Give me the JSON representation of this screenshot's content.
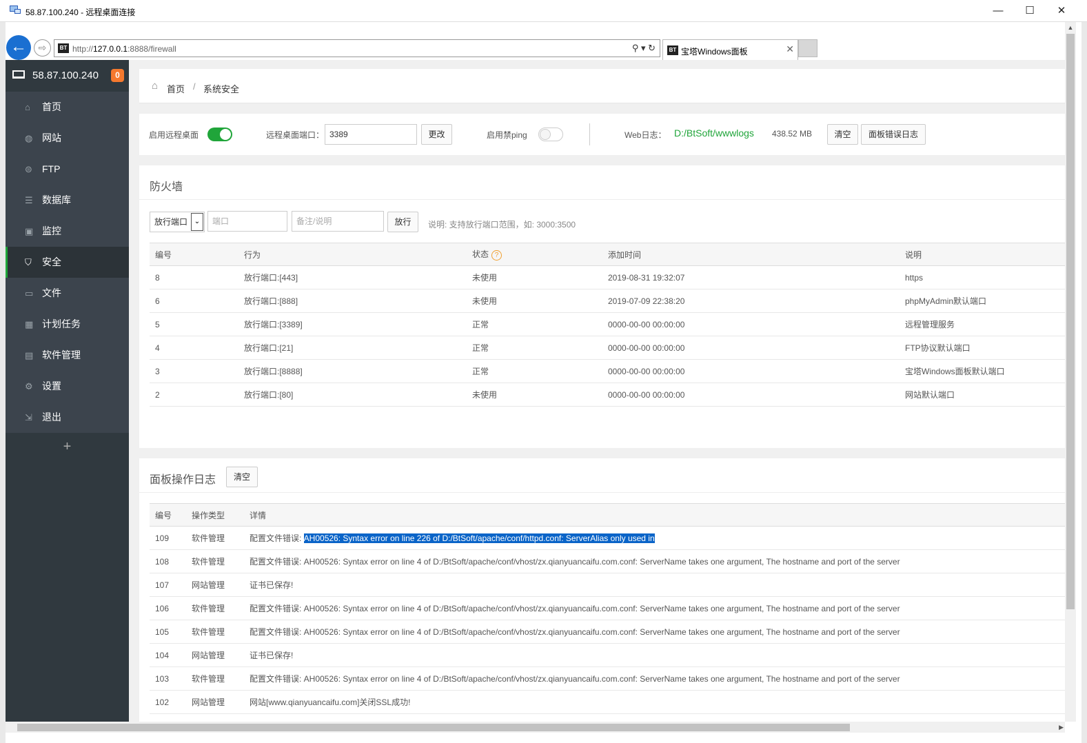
{
  "window": {
    "title": "58.87.100.240 - 远程桌面连接",
    "minimize": "—",
    "maximize": "☐",
    "close": "✕"
  },
  "browser": {
    "url_prefix": "http://",
    "url_host": "127.0.0.1",
    "url_path": ":8888/firewall",
    "tools": "⚲ ▾ ↻",
    "tab_title": "宝塔Windows面板",
    "tab_close": "✕",
    "bt_logo": "BT"
  },
  "sidebar": {
    "ip": "58.87.100.240",
    "badge": "0",
    "add": "+",
    "items": [
      {
        "label": "首页",
        "icon": "⌂"
      },
      {
        "label": "网站",
        "icon": "◍"
      },
      {
        "label": "FTP",
        "icon": "⊜"
      },
      {
        "label": "数据库",
        "icon": "☰"
      },
      {
        "label": "监控",
        "icon": "▣"
      },
      {
        "label": "安全",
        "icon": "⛉"
      },
      {
        "label": "文件",
        "icon": "▭"
      },
      {
        "label": "计划任务",
        "icon": "▦"
      },
      {
        "label": "软件管理",
        "icon": "▤"
      },
      {
        "label": "设置",
        "icon": "⚙"
      },
      {
        "label": "退出",
        "icon": "⇲"
      }
    ]
  },
  "breadcrumb": {
    "home": "首页",
    "sep": "/",
    "current": "系统安全"
  },
  "controls": {
    "remote_desktop_label": "启用远程桌面",
    "remote_port_label": "远程桌面端口：",
    "remote_port_value": "3389",
    "change_btn": "更改",
    "ping_label": "启用禁ping",
    "weblog_label": "Web日志：",
    "weblog_path": "D:/BtSoft/wwwlogs",
    "weblog_size": "438.52 MB",
    "clear_btn": "清空",
    "panel_error_btn": "面板错误日志"
  },
  "firewall": {
    "title": "防火墙",
    "select_value": "放行端口",
    "select_arrow": "⌄",
    "port_placeholder": "端口",
    "note_placeholder": "备注/说明",
    "allow_btn": "放行",
    "hint": "说明: 支持放行端口范围，如: 3000:3500",
    "headers": {
      "id": "编号",
      "action": "行为",
      "status": "状态",
      "status_help": "?",
      "time": "添加时间",
      "note": "说明"
    },
    "rows": [
      {
        "id": "8",
        "action": "放行端口:[443]",
        "status": "未使用",
        "time": "2019-08-31 19:32:07",
        "note": "https"
      },
      {
        "id": "6",
        "action": "放行端口:[888]",
        "status": "未使用",
        "time": "2019-07-09 22:38:20",
        "note": "phpMyAdmin默认端口"
      },
      {
        "id": "5",
        "action": "放行端口:[3389]",
        "status": "正常",
        "time": "0000-00-00 00:00:00",
        "note": "远程管理服务"
      },
      {
        "id": "4",
        "action": "放行端口:[21]",
        "status": "正常",
        "time": "0000-00-00 00:00:00",
        "note": "FTP协议默认端口"
      },
      {
        "id": "3",
        "action": "放行端口:[8888]",
        "status": "正常",
        "time": "0000-00-00 00:00:00",
        "note": "宝塔Windows面板默认端口"
      },
      {
        "id": "2",
        "action": "放行端口:[80]",
        "status": "未使用",
        "time": "0000-00-00 00:00:00",
        "note": "网站默认端口"
      }
    ]
  },
  "oplog": {
    "title": "面板操作日志",
    "clear_btn": "清空",
    "headers": {
      "id": "编号",
      "type": "操作类型",
      "detail": "详情"
    },
    "first_prefix": "配置文件错误: ",
    "first_selected": "AH00526: Syntax error on line 226 of D:/BtSoft/apache/conf/httpd.conf: ServerAlias only used in",
    "rows": [
      {
        "id": "108",
        "type": "软件管理",
        "detail": "配置文件错误: AH00526: Syntax error on line 4 of D:/BtSoft/apache/conf/vhost/zx.qianyuancaifu.com.conf: ServerName takes one argument, The hostname and port of the server"
      },
      {
        "id": "107",
        "type": "网站管理",
        "detail": "证书已保存!"
      },
      {
        "id": "106",
        "type": "软件管理",
        "detail": "配置文件错误: AH00526: Syntax error on line 4 of D:/BtSoft/apache/conf/vhost/zx.qianyuancaifu.com.conf: ServerName takes one argument, The hostname and port of the server"
      },
      {
        "id": "105",
        "type": "软件管理",
        "detail": "配置文件错误: AH00526: Syntax error on line 4 of D:/BtSoft/apache/conf/vhost/zx.qianyuancaifu.com.conf: ServerName takes one argument, The hostname and port of the server"
      },
      {
        "id": "104",
        "type": "网站管理",
        "detail": "证书已保存!"
      },
      {
        "id": "103",
        "type": "软件管理",
        "detail": "配置文件错误: AH00526: Syntax error on line 4 of D:/BtSoft/apache/conf/vhost/zx.qianyuancaifu.com.conf: ServerName takes one argument, The hostname and port of the server"
      },
      {
        "id": "102",
        "type": "网站管理",
        "detail": "网站[www.qianyuancaifu.com]关闭SSL成功!"
      }
    ],
    "first_row": {
      "id": "109",
      "type": "软件管理"
    }
  },
  "scroll": {
    "up": "▲",
    "right": "▶"
  }
}
